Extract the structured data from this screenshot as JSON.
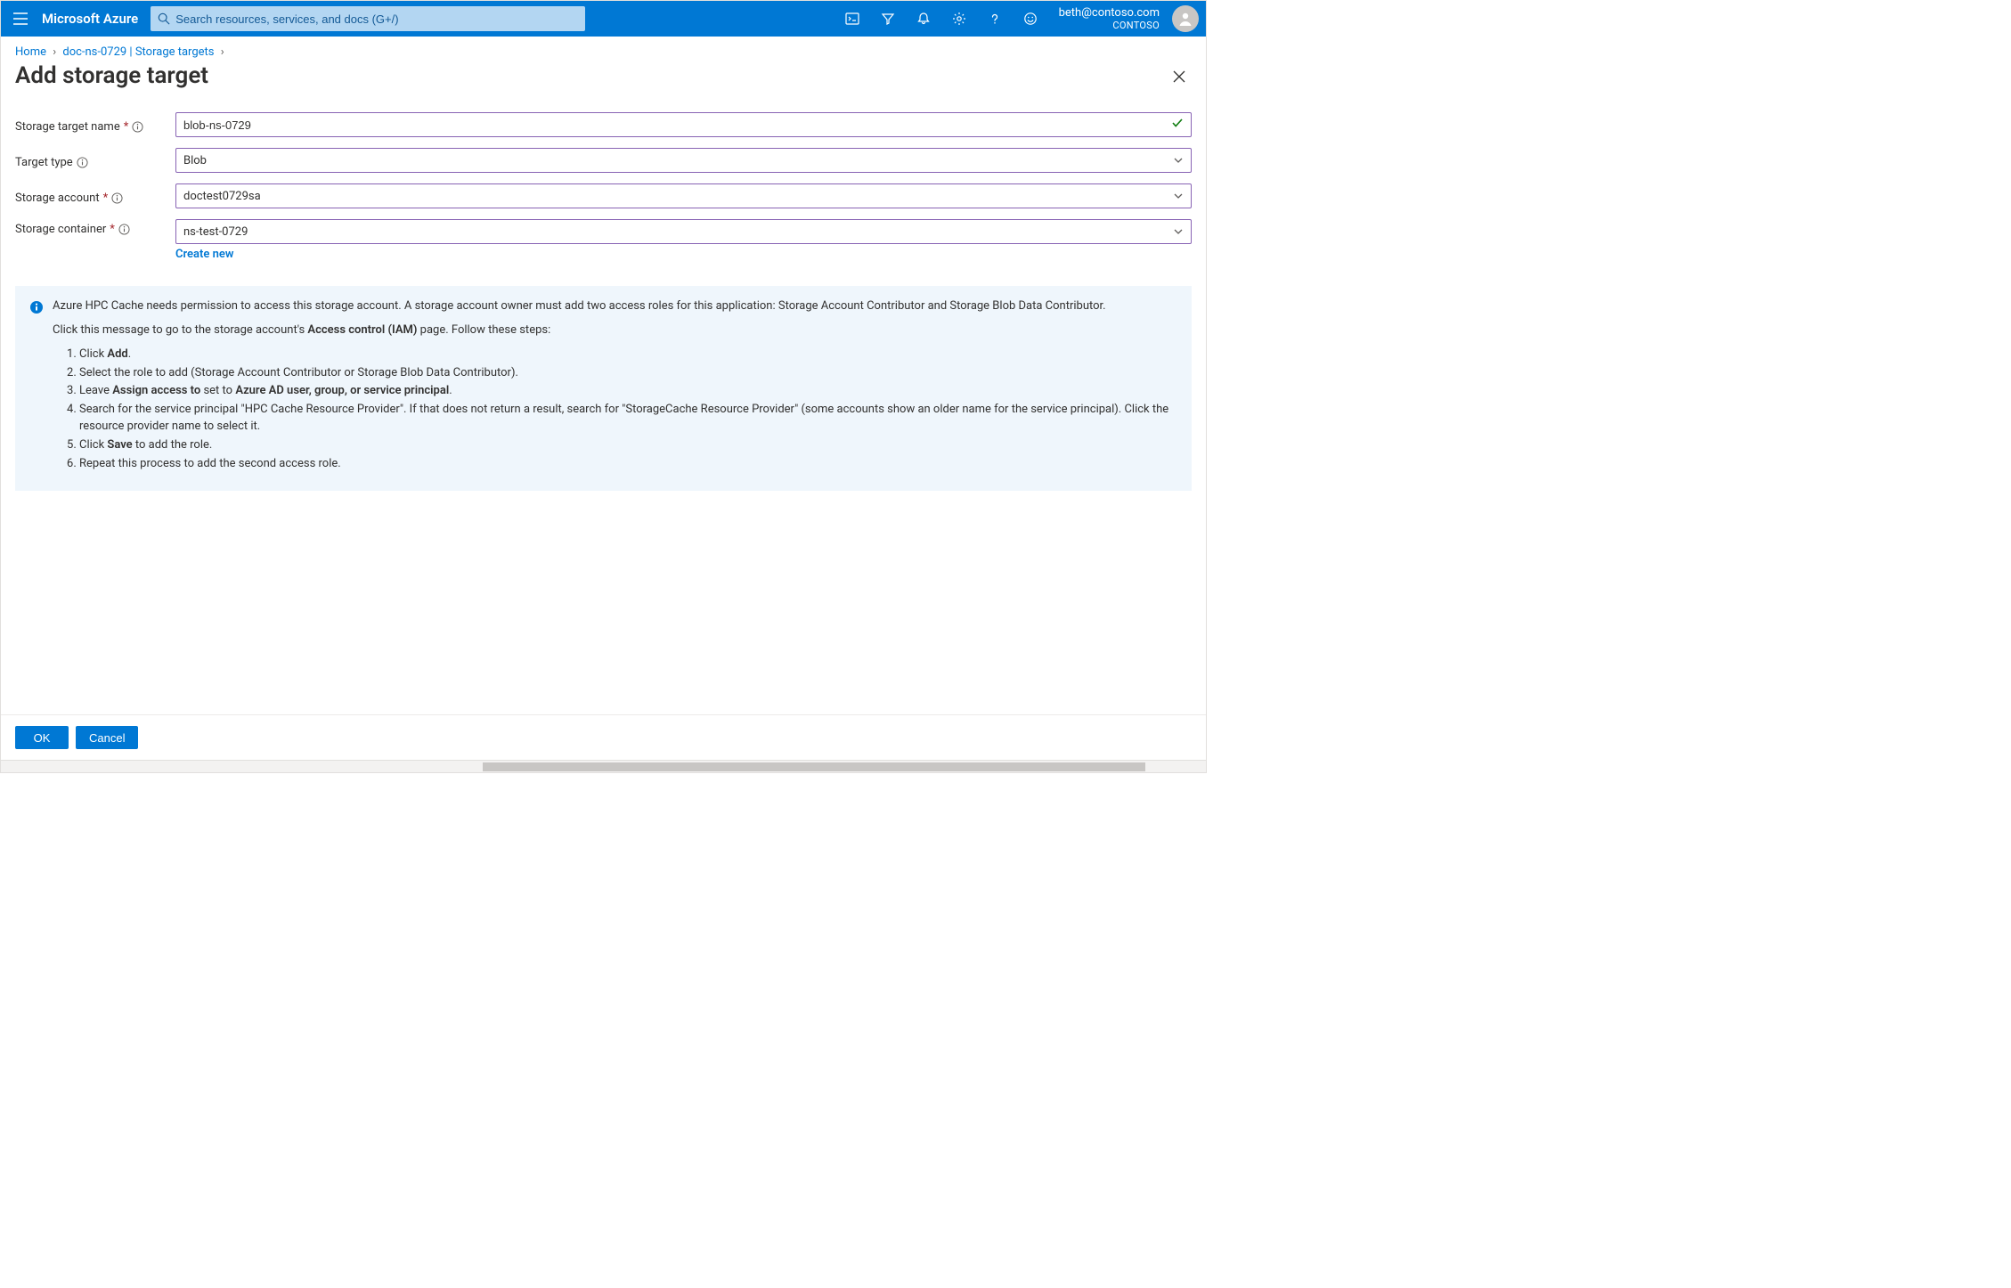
{
  "header": {
    "brand": "Microsoft Azure",
    "search_placeholder": "Search resources, services, and docs (G+/)",
    "user_email": "beth@contoso.com",
    "user_tenant": "CONTOSO"
  },
  "breadcrumb": {
    "home": "Home",
    "path": "doc-ns-0729 | Storage targets"
  },
  "page": {
    "title": "Add storage target"
  },
  "form": {
    "name_label": "Storage target name",
    "name_value": "blob-ns-0729",
    "type_label": "Target type",
    "type_value": "Blob",
    "account_label": "Storage account",
    "account_value": "doctest0729sa",
    "container_label": "Storage container",
    "container_value": "ns-test-0729",
    "create_new": "Create new"
  },
  "info": {
    "lead": "Azure HPC Cache needs permission to access this storage account. A storage account owner must add two access roles for this application: Storage Account Contributor and Storage Blob Data Contributor.",
    "goto_prefix": "Click this message to go to the storage account's ",
    "goto_bold": "Access control (IAM)",
    "goto_suffix": " page. Follow these steps:",
    "step1_a": "Click ",
    "step1_b": "Add",
    "step1_c": ".",
    "step2": "Select the role to add (Storage Account Contributor or Storage Blob Data Contributor).",
    "step3_a": "Leave ",
    "step3_b": "Assign access to",
    "step3_c": " set to ",
    "step3_d": "Azure AD user, group, or service principal",
    "step3_e": ".",
    "step4": "Search for the service principal \"HPC Cache Resource Provider\". If that does not return a result, search for \"StorageCache Resource Provider\" (some accounts show an older name for the service principal). Click the resource provider name to select it.",
    "step5_a": "Click ",
    "step5_b": "Save",
    "step5_c": " to add the role.",
    "step6": "Repeat this process to add the second access role."
  },
  "footer": {
    "ok": "OK",
    "cancel": "Cancel"
  }
}
